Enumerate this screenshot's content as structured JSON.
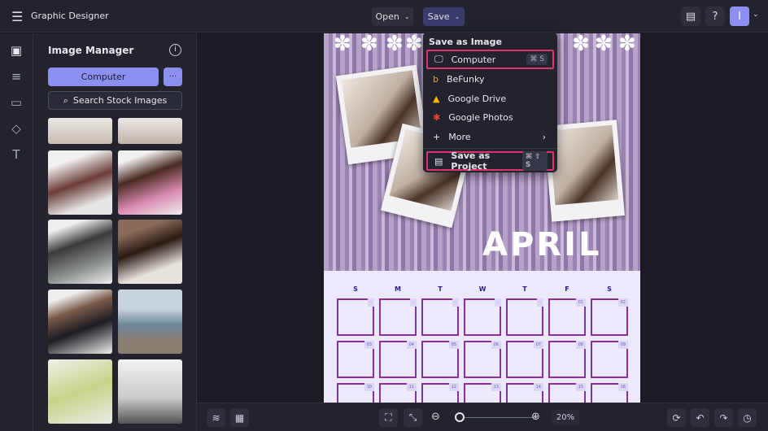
{
  "app": {
    "title": "Graphic Designer",
    "menu_icon": "hamburger-icon"
  },
  "topbar": {
    "open_label": "Open",
    "save_label": "Save",
    "avatar_initial": "I"
  },
  "panel": {
    "title": "Image Manager",
    "computer_label": "Computer",
    "more_label": "···",
    "search_label": "Search Stock Images"
  },
  "save_menu": {
    "heading": "Save as Image",
    "items": [
      {
        "label": "Computer",
        "shortcut": "⌘ S"
      },
      {
        "label": "BeFunky"
      },
      {
        "label": "Google Drive"
      },
      {
        "label": "Google Photos"
      },
      {
        "label": "More"
      }
    ],
    "project": {
      "label": "Save as Project",
      "shortcut": "⌘ ⇧ S"
    }
  },
  "document": {
    "month": "APRIL",
    "days": [
      "S",
      "M",
      "T",
      "W",
      "T",
      "F",
      "S"
    ],
    "dates": [
      "-",
      "-",
      "-",
      "-",
      "-",
      "01",
      "02",
      "03",
      "04",
      "05",
      "06",
      "07",
      "08",
      "09",
      "10",
      "11",
      "12",
      "13",
      "14",
      "15",
      "16"
    ]
  },
  "bottombar": {
    "zoom": "20%",
    "zoom_fraction": 0.05
  },
  "colors": {
    "accent": "#8b8ff0",
    "highlight": "#e0336b",
    "calendar_bg": "#ede8fd"
  }
}
